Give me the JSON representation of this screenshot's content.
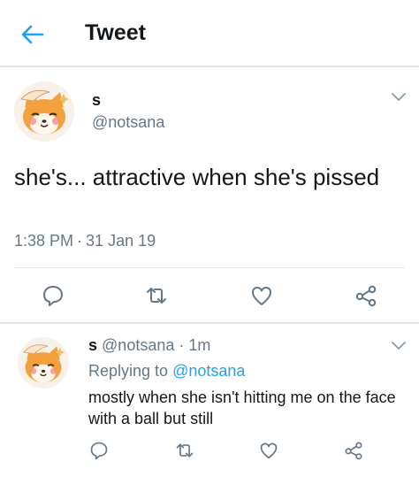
{
  "header": {
    "back_icon": "arrow-left-icon",
    "title": "Tweet",
    "accent_color": "#1da1f2"
  },
  "main_tweet": {
    "name": "s",
    "handle": "@notsana",
    "text": "she's... attractive when she's pissed",
    "time": "1:38 PM",
    "separator": "·",
    "date": "31 Jan 19",
    "actions": [
      "reply-icon",
      "retweet-icon",
      "like-icon",
      "share-icon"
    ]
  },
  "reply": {
    "name": "s",
    "handle": "@notsana",
    "separator": "·",
    "time": "1m",
    "replying_prefix": "Replying to",
    "replying_to": "@notsana",
    "text": "mostly when she isn't hitting me on the face with a ball but still",
    "actions": [
      "reply-icon",
      "retweet-icon",
      "like-icon",
      "share-icon"
    ]
  },
  "colors": {
    "text_primary": "#14171a",
    "text_secondary": "#657786",
    "divider": "#e1e8ed",
    "link": "#1da1f2"
  }
}
